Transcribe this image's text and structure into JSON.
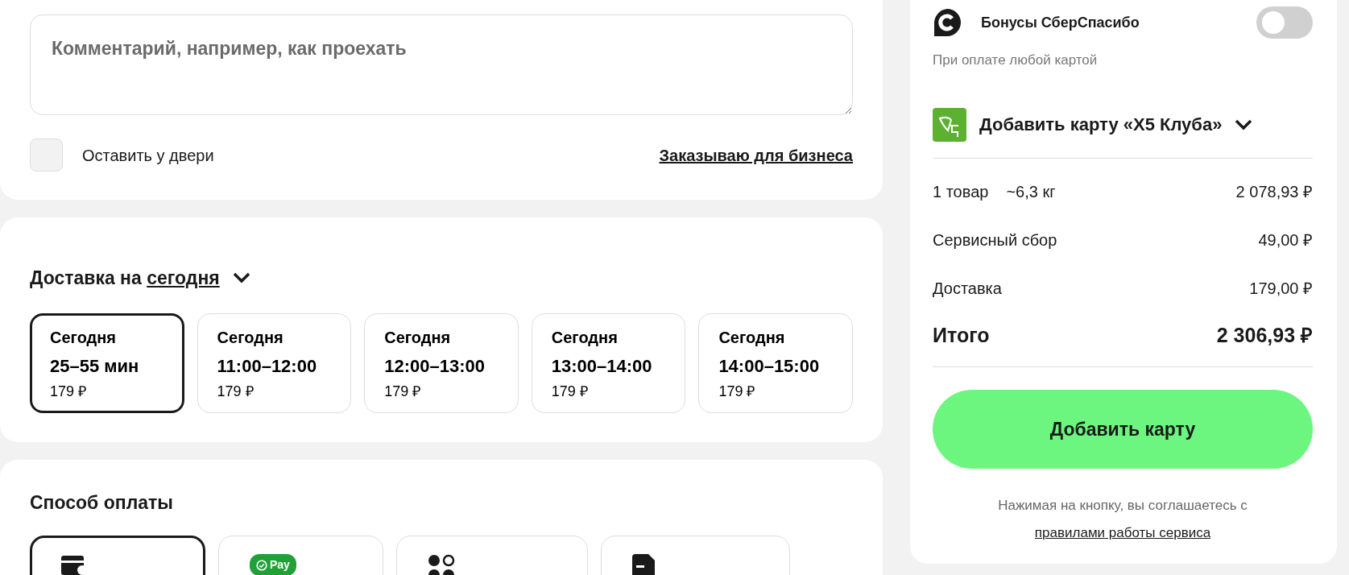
{
  "comment": {
    "placeholder": "Комментарий, например, как проехать"
  },
  "leave_at_door": {
    "label": "Оставить у двери",
    "checked": false
  },
  "business_link": "Заказываю для бизнеса",
  "delivery": {
    "title_prefix": "Доставка на",
    "title_link": "сегодня",
    "slots": [
      {
        "day": "Сегодня",
        "time": "25–55 мин",
        "price": "179 ₽",
        "selected": true
      },
      {
        "day": "Сегодня",
        "time": "11:00–12:00",
        "price": "179 ₽",
        "selected": false
      },
      {
        "day": "Сегодня",
        "time": "12:00–13:00",
        "price": "179 ₽",
        "selected": false
      },
      {
        "day": "Сегодня",
        "time": "13:00–14:00",
        "price": "179 ₽",
        "selected": false
      },
      {
        "day": "Сегодня",
        "time": "14:00–15:00",
        "price": "179 ₽",
        "selected": false
      }
    ]
  },
  "payment": {
    "title": "Способ оплаты",
    "methods": [
      {
        "kind": "card",
        "selected": true
      },
      {
        "kind": "pay",
        "badge": "Pay",
        "selected": false
      },
      {
        "kind": "dots",
        "selected": false
      },
      {
        "kind": "invoice",
        "selected": false
      }
    ]
  },
  "summary": {
    "bonus": {
      "label": "Бонусы СберСпасибо",
      "on": false,
      "note": "При оплате любой картой"
    },
    "club_card": "Добавить карту «X5 Клуба»",
    "rows": [
      {
        "label": "1 товар",
        "extra": "~6,3 кг",
        "value": "2 078,93 ₽"
      },
      {
        "label": "Сервисный сбор",
        "value": "49,00 ₽"
      },
      {
        "label": "Доставка",
        "value": "179,00 ₽"
      }
    ],
    "total": {
      "label": "Итого",
      "value": "2 306,93 ₽"
    },
    "button": "Добавить карту",
    "agreement": "Нажимая на кнопку, вы соглашаетесь с",
    "agreement_link": "правилами работы сервиса"
  }
}
